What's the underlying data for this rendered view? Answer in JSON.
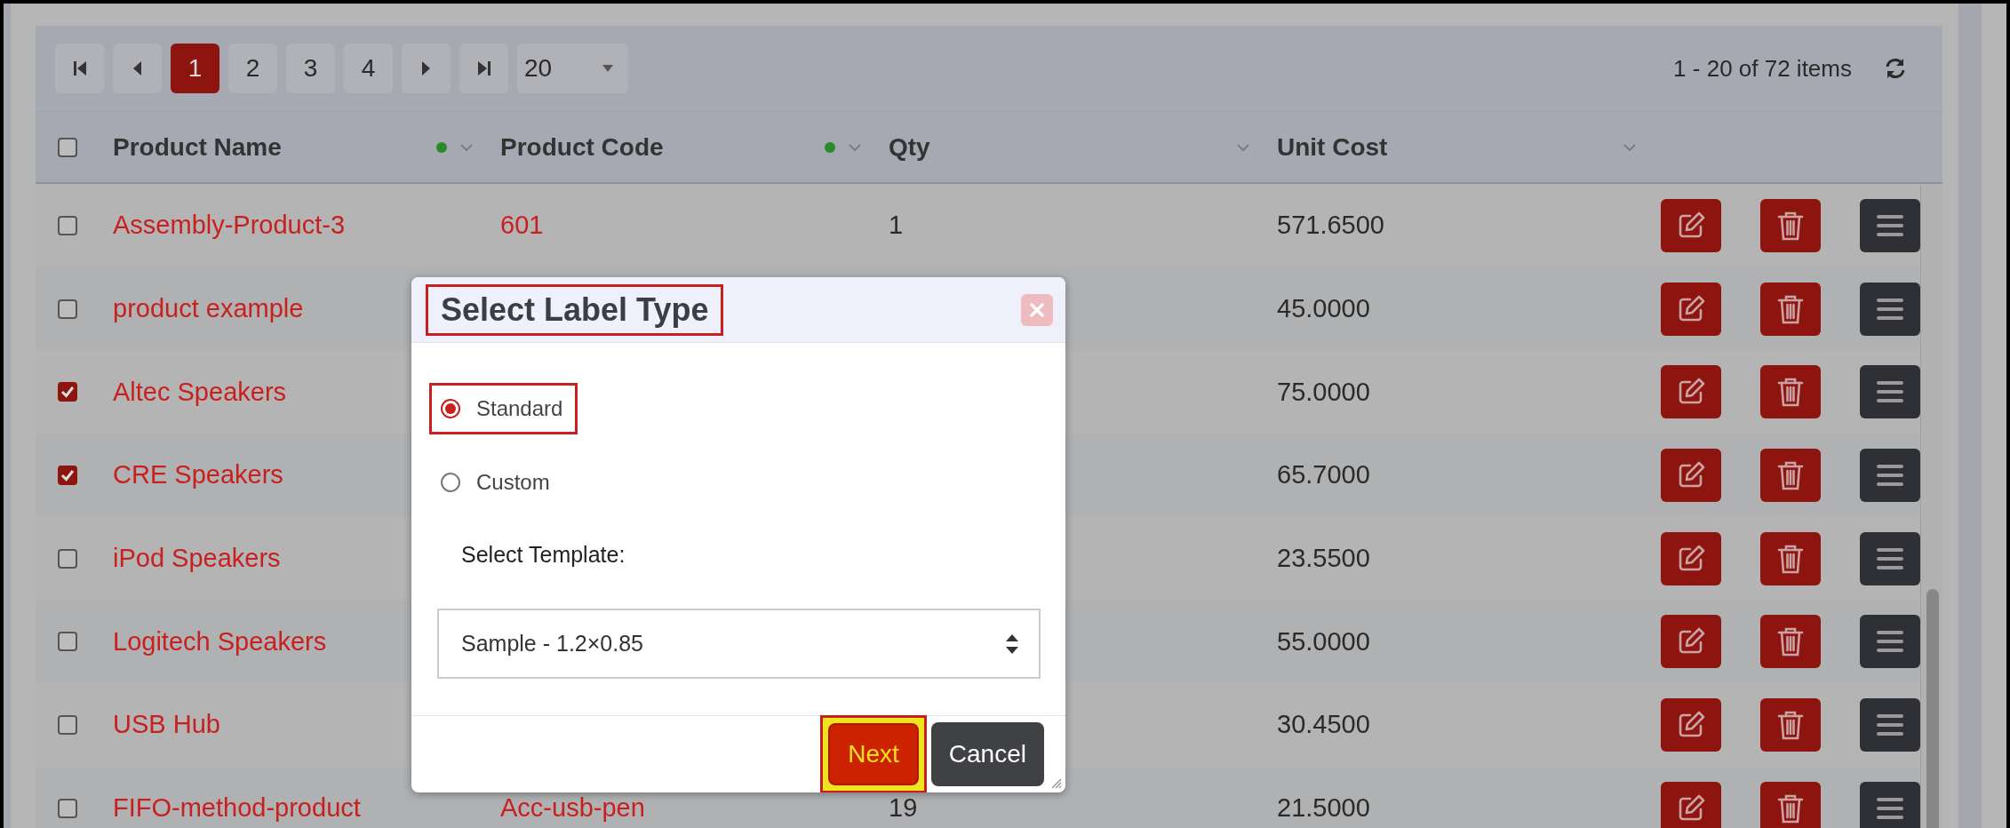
{
  "pager": {
    "pages": [
      {
        "label": "1",
        "selected": true
      },
      {
        "label": "2",
        "selected": false
      },
      {
        "label": "3",
        "selected": false
      },
      {
        "label": "4",
        "selected": false
      }
    ],
    "page_size": "20",
    "summary": "1 - 20 of 72 items"
  },
  "table": {
    "select_all_checked": false,
    "columns": [
      {
        "label": "Product Name",
        "filtered": true
      },
      {
        "label": "Product Code",
        "filtered": true
      },
      {
        "label": "Qty",
        "filtered": false
      },
      {
        "label": "Unit Cost",
        "filtered": false
      }
    ],
    "rows": [
      {
        "checked": false,
        "product_name": "Assembly-Product-3",
        "product_code": "601",
        "qty": "1",
        "unit_cost": "571.6500"
      },
      {
        "checked": false,
        "product_name": "product example",
        "unit_cost": "45.0000"
      },
      {
        "checked": true,
        "product_name": "Altec Speakers",
        "unit_cost": "75.0000"
      },
      {
        "checked": true,
        "product_name": "CRE Speakers",
        "unit_cost": "65.7000"
      },
      {
        "checked": false,
        "product_name": "iPod Speakers",
        "unit_cost": "23.5500"
      },
      {
        "checked": false,
        "product_name": "Logitech Speakers",
        "unit_cost": "55.0000"
      },
      {
        "checked": false,
        "product_name": "USB Hub",
        "unit_cost": "30.4500"
      },
      {
        "checked": false,
        "product_name": "FIFO-method-product",
        "product_code": "Acc-usb-pen",
        "qty": "19",
        "unit_cost": "21.5000"
      }
    ]
  },
  "dialog": {
    "title": "Select Label Type",
    "title_highlighted": true,
    "options": [
      {
        "label": "Standard",
        "selected": true,
        "highlighted": true
      },
      {
        "label": "Custom",
        "selected": false,
        "highlighted": false
      }
    ],
    "template_label": "Select Template:",
    "template_value": "Sample - 1.2×0.85",
    "buttons": [
      {
        "label": "Next",
        "kind": "primary",
        "highlighted": true
      },
      {
        "label": "Cancel",
        "kind": "secondary",
        "highlighted": false
      }
    ]
  }
}
